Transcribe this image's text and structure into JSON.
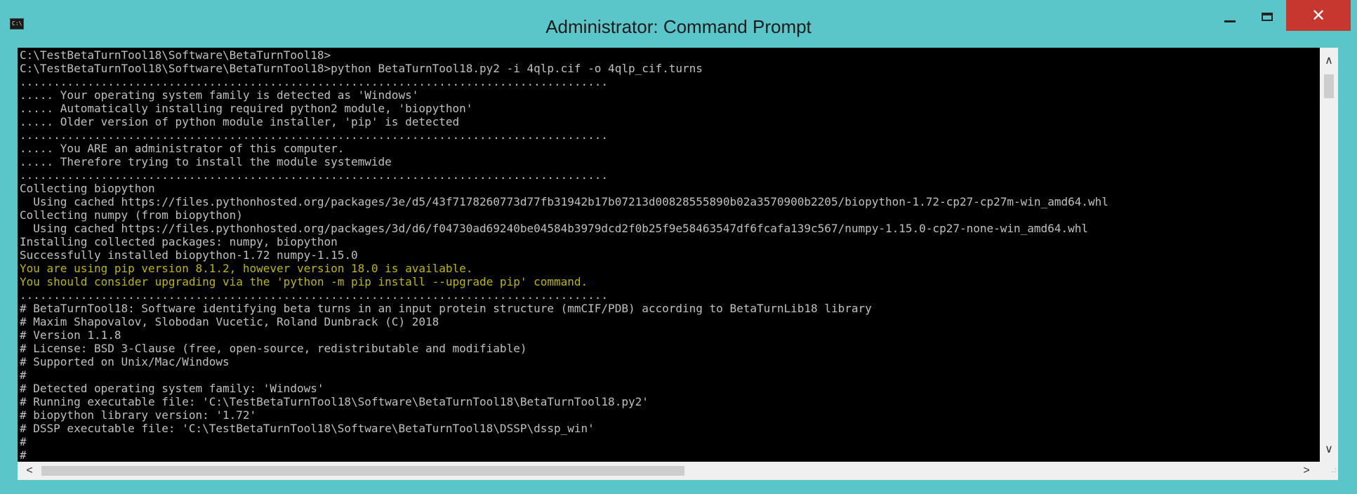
{
  "window": {
    "title": "Administrator: Command Prompt",
    "icon_text": "C:\\.",
    "buttons": {
      "minimize_icon": "minimize-icon",
      "maximize_icon": "maximize-icon",
      "close_label": "✕"
    }
  },
  "console": {
    "lines": [
      {
        "text": "C:\\TestBetaTurnTool18\\Software\\BetaTurnTool18>",
        "color": "default"
      },
      {
        "text": "C:\\TestBetaTurnTool18\\Software\\BetaTurnTool18>python BetaTurnTool18.py2 -i 4qlp.cif -o 4qlp_cif.turns",
        "color": "default"
      },
      {
        "text": ".......................................................................................",
        "color": "default"
      },
      {
        "text": "..... Your operating system family is detected as 'Windows'",
        "color": "default"
      },
      {
        "text": "..... Automatically installing required python2 module, 'biopython'",
        "color": "default"
      },
      {
        "text": "..... Older version of python module installer, 'pip' is detected",
        "color": "default"
      },
      {
        "text": ".......................................................................................",
        "color": "default"
      },
      {
        "text": "..... You ARE an administrator of this computer.",
        "color": "default"
      },
      {
        "text": "..... Therefore trying to install the module systemwide",
        "color": "default"
      },
      {
        "text": ".......................................................................................",
        "color": "default"
      },
      {
        "text": "Collecting biopython",
        "color": "default"
      },
      {
        "text": "  Using cached https://files.pythonhosted.org/packages/3e/d5/43f7178260773d77fb31942b17b07213d00828555890b02a3570900b2205/biopython-1.72-cp27-cp27m-win_amd64.whl",
        "color": "default"
      },
      {
        "text": "Collecting numpy (from biopython)",
        "color": "default"
      },
      {
        "text": "  Using cached https://files.pythonhosted.org/packages/3d/d6/f04730ad69240be04584b3979dcd2f0b25f9e58463547df6fcafa139c567/numpy-1.15.0-cp27-none-win_amd64.whl",
        "color": "default"
      },
      {
        "text": "Installing collected packages: numpy, biopython",
        "color": "default"
      },
      {
        "text": "Successfully installed biopython-1.72 numpy-1.15.0",
        "color": "default"
      },
      {
        "text": "You are using pip version 8.1.2, however version 18.0 is available.",
        "color": "warning"
      },
      {
        "text": "You should consider upgrading via the 'python -m pip install --upgrade pip' command.",
        "color": "warning"
      },
      {
        "text": ".......................................................................................",
        "color": "default"
      },
      {
        "text": "# BetaTurnTool18: Software identifying beta turns in an input protein structure (mmCIF/PDB) according to BetaTurnLib18 library",
        "color": "default"
      },
      {
        "text": "# Maxim Shapovalov, Slobodan Vucetic, Roland Dunbrack (C) 2018",
        "color": "default"
      },
      {
        "text": "# Version 1.1.8",
        "color": "default"
      },
      {
        "text": "# License: BSD 3-Clause (free, open-source, redistributable and modifiable)",
        "color": "default"
      },
      {
        "text": "# Supported on Unix/Mac/Windows",
        "color": "default"
      },
      {
        "text": "#",
        "color": "default"
      },
      {
        "text": "# Detected operating system family: 'Windows'",
        "color": "default"
      },
      {
        "text": "# Running executable file: 'C:\\TestBetaTurnTool18\\Software\\BetaTurnTool18\\BetaTurnTool18.py2'",
        "color": "default"
      },
      {
        "text": "# biopython library version: '1.72'",
        "color": "default"
      },
      {
        "text": "# DSSP executable file: 'C:\\TestBetaTurnTool18\\Software\\BetaTurnTool18\\DSSP\\dssp_win'",
        "color": "default"
      },
      {
        "text": "#",
        "color": "default"
      },
      {
        "text": "#",
        "color": "default"
      }
    ]
  },
  "scrollbars": {
    "up_arrow": "∧",
    "down_arrow": "∨",
    "left_arrow": "<",
    "right_arrow": ">",
    "grip": "..:"
  },
  "colors": {
    "titlebar": "#5BC6C9",
    "console_bg": "#000000",
    "text_default": "#C0C0C0",
    "text_warning": "#BDB700",
    "close_button": "#C7372F"
  }
}
